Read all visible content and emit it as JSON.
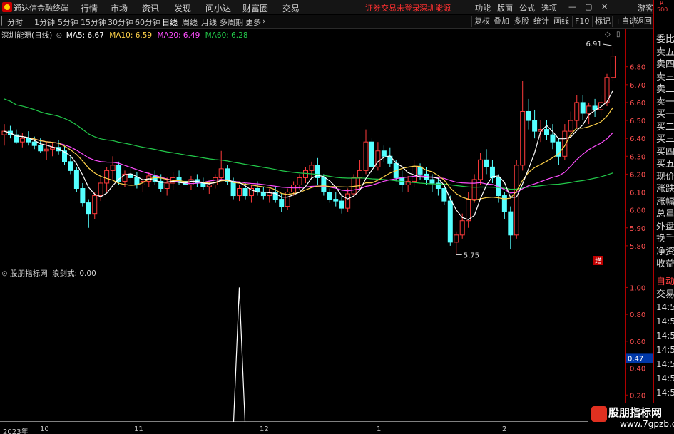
{
  "menubar": {
    "app_title": "通达信金融终端",
    "items": [
      "行情",
      "市场",
      "资讯",
      "发现",
      "问小达",
      "财富圈",
      "交易"
    ],
    "status_notice": "证券交易未登录",
    "stock_name": "深圳能源",
    "right_items": [
      "功能",
      "版面",
      "公式",
      "选项"
    ],
    "user": "游客"
  },
  "periodbar": {
    "tabs": [
      "分时",
      "1分钟",
      "5分钟",
      "15分钟",
      "30分钟",
      "60分钟",
      "日线",
      "周线",
      "月线",
      "多周期",
      "更多"
    ],
    "active_tab": "日线",
    "right_buttons": [
      "复权",
      "叠加",
      "多股",
      "统计",
      "画线",
      "F10",
      "标记",
      "+自选",
      "返回"
    ]
  },
  "main_chart": {
    "title": "深圳能源(日线)",
    "ma5_label": "MA5: 6.67",
    "ma10_label": "MA10: 6.59",
    "ma20_label": "MA20: 6.49",
    "ma60_label": "MA60: 6.28",
    "high_label": "6.91",
    "low_label": "5.75",
    "rise_flag": "增",
    "colors": {
      "up": "#ff3b3b",
      "down": "#54ffff",
      "ma5": "#ffffff",
      "ma10": "#ffd24a",
      "ma20": "#ff4dff",
      "ma60": "#22c94a"
    }
  },
  "indicator_chart": {
    "title": "股朋指标网",
    "value_label": "浪剑式: 0.00"
  },
  "price_axis": [
    "6.80",
    "6.70",
    "6.60",
    "6.50",
    "6.40",
    "6.30",
    "6.20",
    "6.10",
    "6.00",
    "5.90",
    "5.80"
  ],
  "indicator_axis": [
    "1.00",
    "0.80",
    "0.60",
    "0.40",
    "0.20"
  ],
  "indicator_current": "0.47",
  "right_panel": {
    "header_r": "R",
    "header_500": "500",
    "quote_labels": [
      "委比",
      "卖五",
      "卖四",
      "卖三",
      "卖二",
      "卖一",
      "买一",
      "买二",
      "买三",
      "买四",
      "买五",
      "现价",
      "涨跌",
      "涨幅",
      "总量",
      "外盘",
      "换手",
      "净资",
      "收益"
    ],
    "tabs": [
      "自动",
      "交易"
    ],
    "times": [
      "14:56",
      "14:56",
      "14:56",
      "14:56",
      "14:56",
      "14:56",
      "14:56"
    ]
  },
  "date_axis": {
    "year": "2023年",
    "months": [
      "10",
      "11",
      "12",
      "1",
      "2"
    ]
  },
  "watermark": {
    "title": "股朋指标网",
    "url": "www.7gpzb.com"
  },
  "chart_data": {
    "type": "candlestick",
    "title": "深圳能源(日线)",
    "ylim": [
      5.7,
      6.95
    ],
    "candles": [
      [
        6.42,
        6.48,
        6.36,
        6.44
      ],
      [
        6.44,
        6.47,
        6.4,
        6.42
      ],
      [
        6.42,
        6.45,
        6.37,
        6.38
      ],
      [
        6.38,
        6.43,
        6.35,
        6.4
      ],
      [
        6.4,
        6.44,
        6.36,
        6.38
      ],
      [
        6.38,
        6.41,
        6.34,
        6.36
      ],
      [
        6.36,
        6.4,
        6.32,
        6.33
      ],
      [
        6.33,
        6.38,
        6.28,
        6.34
      ],
      [
        6.34,
        6.38,
        6.3,
        6.35
      ],
      [
        6.35,
        6.39,
        6.31,
        6.33
      ],
      [
        6.33,
        6.36,
        6.25,
        6.27
      ],
      [
        6.27,
        6.3,
        6.2,
        6.22
      ],
      [
        6.22,
        6.24,
        6.1,
        6.12
      ],
      [
        6.12,
        6.15,
        6.02,
        6.04
      ],
      [
        6.04,
        6.06,
        5.9,
        5.98
      ],
      [
        5.98,
        6.1,
        5.95,
        6.08
      ],
      [
        6.08,
        6.18,
        6.05,
        6.15
      ],
      [
        6.15,
        6.24,
        6.1,
        6.22
      ],
      [
        6.22,
        6.3,
        6.17,
        6.25
      ],
      [
        6.25,
        6.27,
        6.14,
        6.16
      ],
      [
        6.16,
        6.22,
        6.13,
        6.2
      ],
      [
        6.2,
        6.25,
        6.15,
        6.18
      ],
      [
        6.18,
        6.21,
        6.12,
        6.14
      ],
      [
        6.14,
        6.18,
        6.1,
        6.16
      ],
      [
        6.16,
        6.21,
        6.13,
        6.19
      ],
      [
        6.19,
        6.22,
        6.14,
        6.16
      ],
      [
        6.16,
        6.2,
        6.1,
        6.12
      ],
      [
        6.12,
        6.18,
        6.08,
        6.15
      ],
      [
        6.15,
        6.21,
        6.11,
        6.18
      ],
      [
        6.18,
        6.22,
        6.14,
        6.16
      ],
      [
        6.16,
        6.19,
        6.12,
        6.14
      ],
      [
        6.14,
        6.19,
        6.11,
        6.17
      ],
      [
        6.17,
        6.2,
        6.13,
        6.15
      ],
      [
        6.15,
        6.18,
        6.11,
        6.13
      ],
      [
        6.13,
        6.16,
        6.09,
        6.14
      ],
      [
        6.14,
        6.2,
        6.12,
        6.18
      ],
      [
        6.18,
        6.33,
        6.16,
        6.23
      ],
      [
        6.23,
        6.25,
        6.14,
        6.16
      ],
      [
        6.16,
        6.18,
        6.06,
        6.08
      ],
      [
        6.08,
        6.14,
        6.05,
        6.12
      ],
      [
        6.12,
        6.15,
        6.06,
        6.08
      ],
      [
        6.08,
        6.14,
        6.04,
        6.12
      ],
      [
        6.12,
        6.16,
        6.08,
        6.1
      ],
      [
        6.1,
        6.13,
        6.06,
        6.08
      ],
      [
        6.08,
        6.12,
        6.04,
        6.1
      ],
      [
        6.1,
        6.13,
        6.04,
        6.06
      ],
      [
        6.06,
        6.09,
        5.99,
        6.02
      ],
      [
        6.02,
        6.12,
        6.0,
        6.1
      ],
      [
        6.1,
        6.16,
        6.08,
        6.14
      ],
      [
        6.14,
        6.2,
        6.11,
        6.18
      ],
      [
        6.18,
        6.24,
        6.15,
        6.22
      ],
      [
        6.22,
        6.27,
        6.18,
        6.25
      ],
      [
        6.25,
        6.29,
        6.14,
        6.18
      ],
      [
        6.18,
        6.2,
        6.08,
        6.1
      ],
      [
        6.1,
        6.12,
        6.04,
        6.06
      ],
      [
        6.06,
        6.1,
        6.02,
        6.05
      ],
      [
        6.05,
        6.08,
        5.98,
        6.01
      ],
      [
        6.01,
        6.12,
        5.99,
        6.09
      ],
      [
        6.09,
        6.2,
        6.07,
        6.18
      ],
      [
        6.18,
        6.28,
        6.12,
        6.22
      ],
      [
        6.22,
        6.45,
        6.2,
        6.38
      ],
      [
        6.38,
        6.4,
        6.2,
        6.24
      ],
      [
        6.24,
        6.38,
        6.22,
        6.33
      ],
      [
        6.33,
        6.36,
        6.27,
        6.3
      ],
      [
        6.3,
        6.35,
        6.24,
        6.26
      ],
      [
        6.26,
        6.28,
        6.16,
        6.18
      ],
      [
        6.18,
        6.22,
        6.1,
        6.14
      ],
      [
        6.14,
        6.19,
        6.1,
        6.16
      ],
      [
        6.16,
        6.28,
        6.13,
        6.24
      ],
      [
        6.24,
        6.26,
        6.17,
        6.2
      ],
      [
        6.2,
        6.24,
        6.14,
        6.17
      ],
      [
        6.17,
        6.2,
        6.1,
        6.15
      ],
      [
        6.15,
        6.18,
        6.08,
        6.12
      ],
      [
        6.12,
        6.14,
        6.03,
        6.05
      ],
      [
        6.05,
        6.08,
        5.8,
        5.82
      ],
      [
        5.82,
        5.88,
        5.75,
        5.86
      ],
      [
        5.86,
        5.98,
        5.84,
        5.94
      ],
      [
        5.94,
        6.1,
        5.9,
        6.06
      ],
      [
        6.06,
        6.2,
        6.04,
        6.17
      ],
      [
        6.17,
        6.32,
        6.14,
        6.28
      ],
      [
        6.28,
        6.34,
        6.2,
        6.24
      ],
      [
        6.24,
        6.28,
        6.15,
        6.18
      ],
      [
        6.18,
        6.2,
        6.04,
        6.08
      ],
      [
        6.08,
        6.1,
        5.95,
        5.99
      ],
      [
        5.99,
        6.02,
        5.78,
        5.86
      ],
      [
        5.86,
        6.28,
        5.84,
        6.25
      ],
      [
        6.25,
        6.72,
        6.22,
        6.55
      ],
      [
        6.55,
        6.62,
        6.45,
        6.5
      ],
      [
        6.5,
        6.56,
        6.4,
        6.44
      ],
      [
        6.44,
        6.5,
        6.38,
        6.45
      ],
      [
        6.45,
        6.5,
        6.39,
        6.42
      ],
      [
        6.42,
        6.48,
        6.34,
        6.38
      ],
      [
        6.38,
        6.4,
        6.25,
        6.3
      ],
      [
        6.3,
        6.48,
        6.28,
        6.44
      ],
      [
        6.44,
        6.55,
        6.4,
        6.5
      ],
      [
        6.5,
        6.64,
        6.46,
        6.6
      ],
      [
        6.6,
        6.64,
        6.5,
        6.54
      ],
      [
        6.54,
        6.6,
        6.48,
        6.58
      ],
      [
        6.58,
        6.62,
        6.52,
        6.56
      ],
      [
        6.56,
        6.64,
        6.52,
        6.6
      ],
      [
        6.6,
        6.76,
        6.58,
        6.74
      ],
      [
        6.74,
        6.91,
        6.72,
        6.86
      ]
    ],
    "indicator": {
      "name": "浪剑式",
      "spike_index": 39,
      "spike_value": 1.0,
      "ylim": [
        0,
        1.05
      ]
    }
  }
}
